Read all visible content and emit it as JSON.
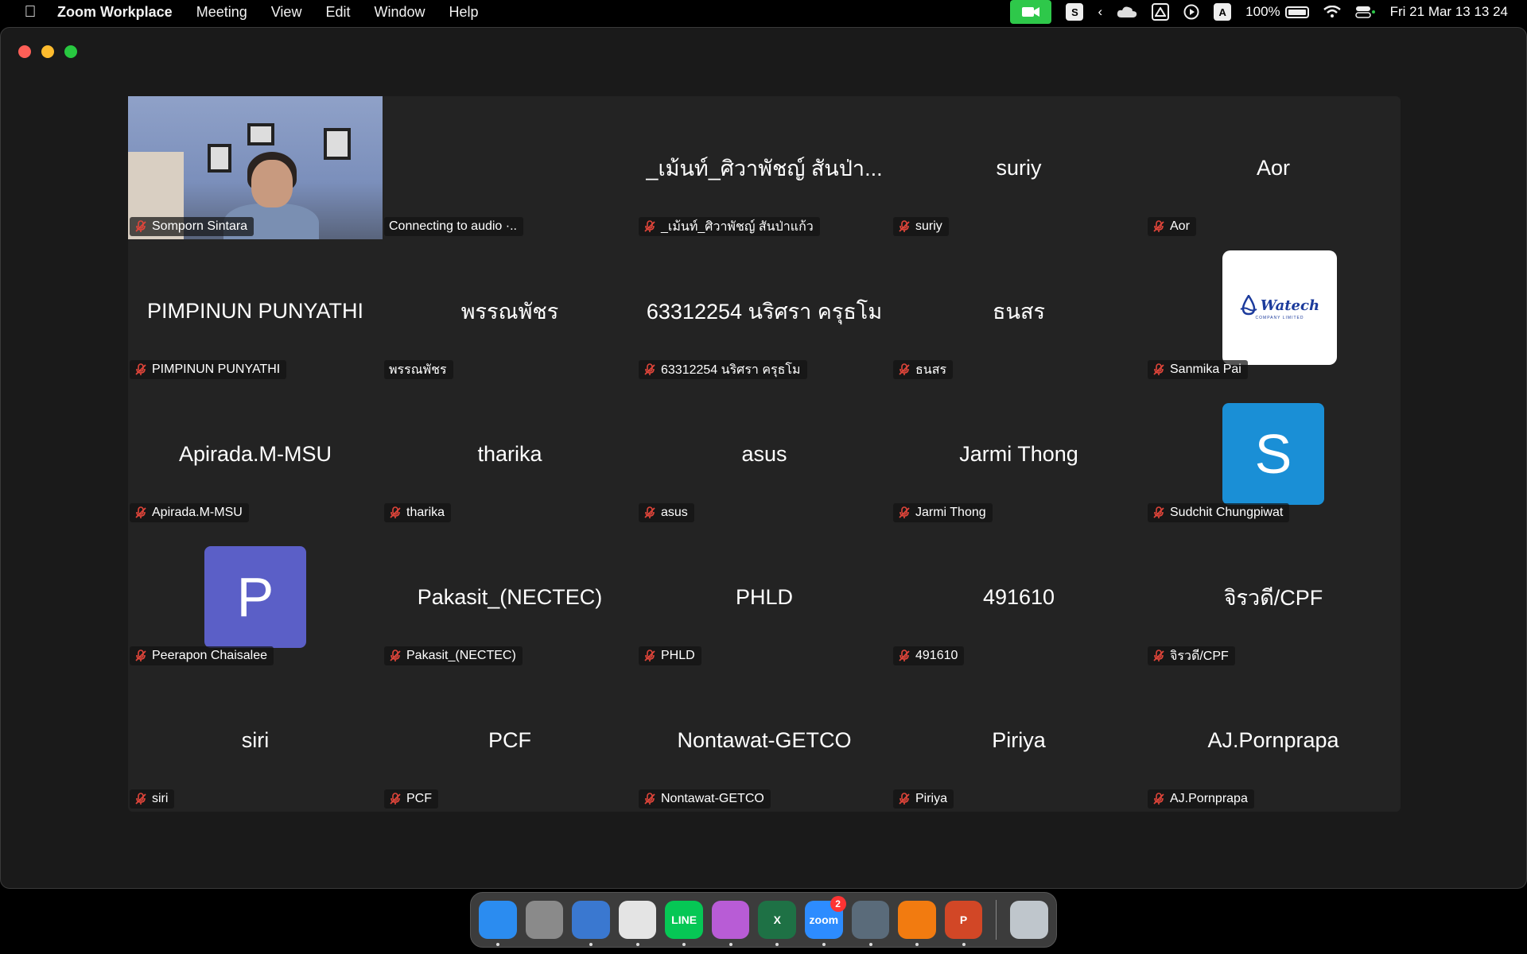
{
  "menubar": {
    "app_name": "Zoom Workplace",
    "menus": [
      "Meeting",
      "View",
      "Edit",
      "Window",
      "Help"
    ],
    "battery": "100%",
    "datetime": "Fri 21 Mar  13 13 24",
    "status_icons": [
      "zoom-video-icon",
      "s-icon",
      "chevron-left-icon",
      "cloud-icon",
      "drive-icon",
      "play-icon",
      "a-icon",
      "battery-icon",
      "wifi-icon",
      "control-center-icon"
    ]
  },
  "tiles": [
    {
      "display": "",
      "tag": "Somporn Sintara",
      "muted": true,
      "type": "video"
    },
    {
      "display": "",
      "tag": "Connecting to audio  ·..",
      "muted": false,
      "type": "blank"
    },
    {
      "display": "_เม้นท์_ศิวาพัชญ์ สันป่า...",
      "tag": "_เม้นท์_ศิวาพัชญ์ สันป่าแก้ว",
      "muted": true,
      "type": "name"
    },
    {
      "display": "suriy",
      "tag": "suriy",
      "muted": true,
      "type": "name"
    },
    {
      "display": "Aor",
      "tag": "Aor",
      "muted": true,
      "type": "name"
    },
    {
      "display": "PIMPINUN PUNYATHI",
      "tag": "PIMPINUN PUNYATHI",
      "muted": true,
      "type": "name"
    },
    {
      "display": "พรรณพัชร",
      "tag": "พรรณพัชร",
      "muted": false,
      "type": "name"
    },
    {
      "display": "63312254 นริศรา ครุธโม",
      "tag": "63312254 นริศรา ครุธโม",
      "muted": true,
      "type": "name"
    },
    {
      "display": "ธนสร",
      "tag": "ธนสร",
      "muted": true,
      "type": "name"
    },
    {
      "display": "",
      "tag": "Sanmika Pai",
      "muted": true,
      "type": "logo",
      "logo_text": "Watech",
      "logo_sub": "COMPANY LIMITED"
    },
    {
      "display": "Apirada.M-MSU",
      "tag": "Apirada.M-MSU",
      "muted": true,
      "type": "name"
    },
    {
      "display": "tharika",
      "tag": "tharika",
      "muted": true,
      "type": "name"
    },
    {
      "display": "asus",
      "tag": "asus",
      "muted": true,
      "type": "name"
    },
    {
      "display": "Jarmi Thong",
      "tag": "Jarmi Thong",
      "muted": true,
      "type": "name"
    },
    {
      "display": "",
      "tag": "Sudchit Chungpiwat",
      "muted": true,
      "type": "letter",
      "letter": "S",
      "color": "#1a8fd6"
    },
    {
      "display": "",
      "tag": "Peerapon Chaisalee",
      "muted": true,
      "type": "letter",
      "letter": "P",
      "color": "#5b5fc7"
    },
    {
      "display": "Pakasit_(NECTEC)",
      "tag": "Pakasit_(NECTEC)",
      "muted": true,
      "type": "name"
    },
    {
      "display": "PHLD",
      "tag": "PHLD",
      "muted": true,
      "type": "name"
    },
    {
      "display": "491610",
      "tag": "491610",
      "muted": true,
      "type": "name"
    },
    {
      "display": "จิรวดี/CPF",
      "tag": "จิรวดี/CPF",
      "muted": true,
      "type": "name"
    },
    {
      "display": "siri",
      "tag": "siri",
      "muted": true,
      "type": "name"
    },
    {
      "display": "PCF",
      "tag": "PCF",
      "muted": true,
      "type": "name"
    },
    {
      "display": "Nontawat-GETCO",
      "tag": "Nontawat-GETCO",
      "muted": true,
      "type": "name"
    },
    {
      "display": "Piriya",
      "tag": "Piriya",
      "muted": true,
      "type": "name"
    },
    {
      "display": "AJ.Pornprapa",
      "tag": "AJ.Pornprapa",
      "muted": true,
      "type": "name"
    }
  ],
  "dock": [
    {
      "name": "finder-icon",
      "color": "#2b8cf0",
      "running": true
    },
    {
      "name": "launchpad-icon",
      "color": "#8a8a8a",
      "running": false
    },
    {
      "name": "thunderbird-icon",
      "color": "#3a78d0",
      "running": true
    },
    {
      "name": "chrome-icon",
      "color": "#e4e4e4",
      "running": true
    },
    {
      "name": "line-icon",
      "color": "#06c755",
      "running": true,
      "label": "LINE"
    },
    {
      "name": "flower-app-icon",
      "color": "#b85cd6",
      "running": true
    },
    {
      "name": "excel-icon",
      "color": "#1e7145",
      "running": true,
      "label": "X"
    },
    {
      "name": "zoom-icon",
      "color": "#2d8cff",
      "running": true,
      "label": "zoom",
      "badge": "2"
    },
    {
      "name": "quicktime-icon",
      "color": "#5a6b7a",
      "running": true
    },
    {
      "name": "vlc-icon",
      "color": "#f27b10",
      "running": true
    },
    {
      "name": "powerpoint-icon",
      "color": "#d24726",
      "running": true,
      "label": "P"
    }
  ],
  "trash": {
    "name": "trash-icon",
    "color": "#bfc6cc"
  }
}
